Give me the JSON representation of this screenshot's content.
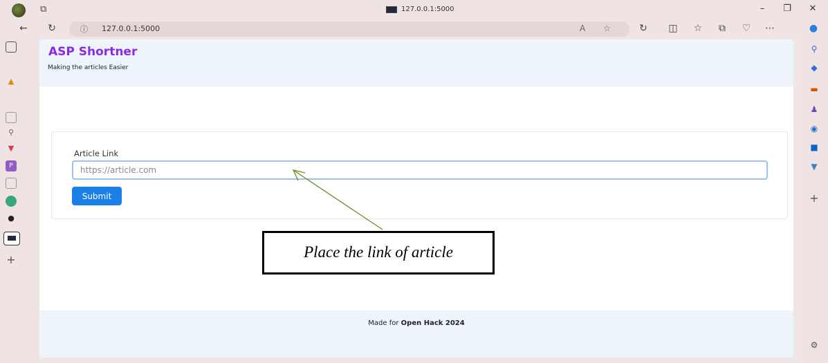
{
  "browser": {
    "tab_title": "127.0.0.1:5000",
    "address": "127.0.0.1:5000",
    "window_controls": [
      "minimize-icon",
      "restore-icon",
      "close-icon"
    ]
  },
  "site": {
    "brand": "ASP Shortner",
    "tagline": "Making the articles Easier"
  },
  "form": {
    "label": "Article Link",
    "placeholder": "https://article.com",
    "value": "",
    "submit_label": "Submit"
  },
  "footer": {
    "prefix": "Made for ",
    "event": "Open Hack 2024"
  },
  "annotation": {
    "text": "Place the link of article",
    "arrow_color": "#6b8e23"
  },
  "colors": {
    "brand": "#8a2be2",
    "primary": "#1a7fe6",
    "header_bg": "#eef4fb"
  }
}
